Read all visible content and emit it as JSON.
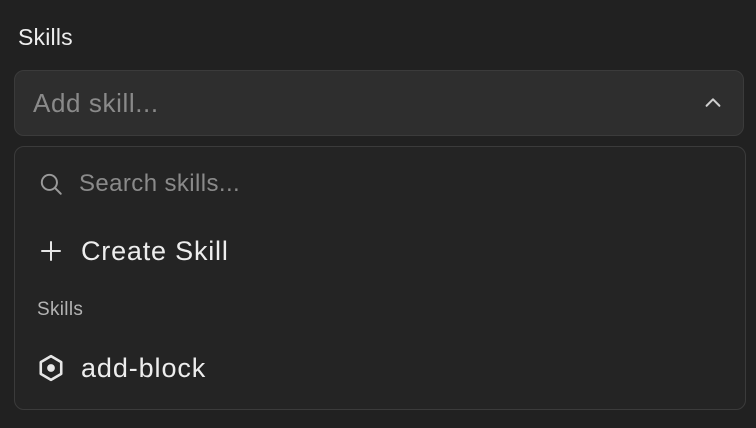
{
  "field": {
    "label": "Skills"
  },
  "select": {
    "placeholder": "Add skill...",
    "icon": "chevron-up-icon"
  },
  "dropdown": {
    "search": {
      "placeholder": "Search skills...",
      "value": "",
      "icon": "search-icon"
    },
    "create": {
      "label": "Create Skill",
      "icon": "plus-icon"
    },
    "group": {
      "label": "Skills",
      "items": [
        {
          "label": "add-block",
          "icon": "hexagon-icon"
        }
      ]
    }
  },
  "colors": {
    "background": "#212121",
    "surface": "#2e2e2e",
    "dropdown_surface": "#242424",
    "border": "#3b3b3b",
    "text": "#ededed",
    "muted_text": "#8a8a8a"
  }
}
